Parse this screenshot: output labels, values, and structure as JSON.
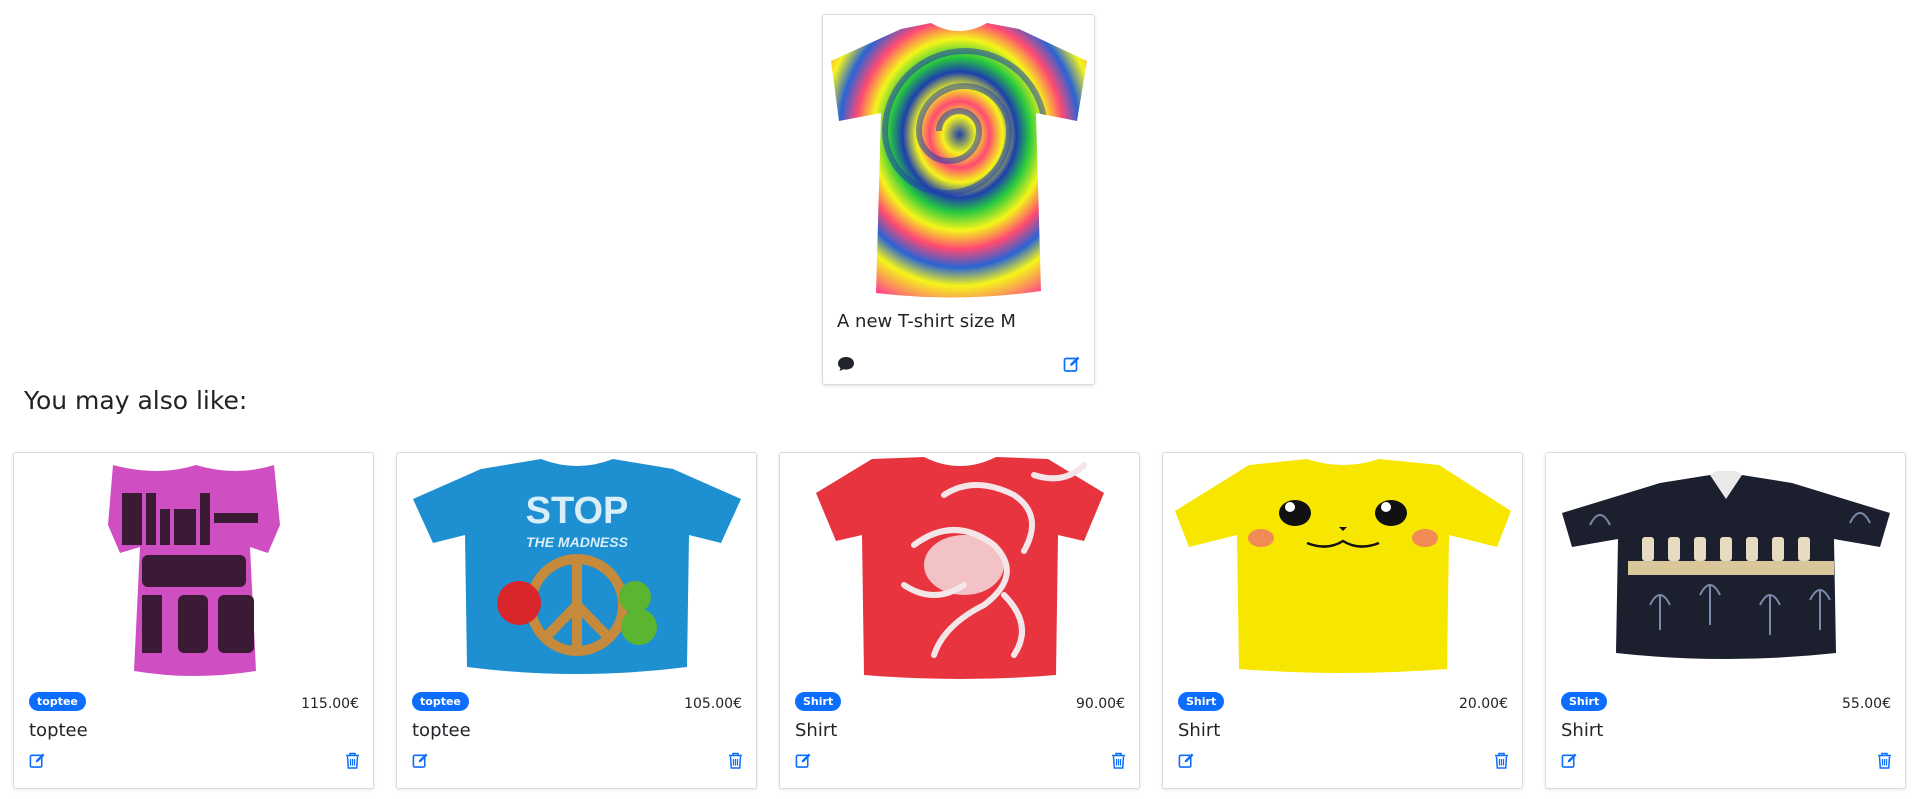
{
  "featured": {
    "title": "A new T-shirt size M",
    "image_icon": "tie-dye-tshirt-image",
    "comment_icon": "comment-icon",
    "edit_icon": "edit-icon"
  },
  "section_heading": "You may also like:",
  "colors": {
    "accent": "#0d6efd",
    "text": "#212529",
    "border": "#dcdcdc"
  },
  "products": [
    {
      "badge": "toptee",
      "price": "115.00€",
      "name": "toptee",
      "image": "pink-blink-182-tshirt-image",
      "shirt_color": "#cf4fc3"
    },
    {
      "badge": "toptee",
      "price": "105.00€",
      "name": "toptee",
      "image": "blue-stop-the-madness-tshirt-image",
      "shirt_color": "#1e8fd0"
    },
    {
      "badge": "Shirt",
      "price": "90.00€",
      "name": "Shirt",
      "image": "red-graphic-tshirt-image",
      "shirt_color": "#e8343f"
    },
    {
      "badge": "Shirt",
      "price": "20.00€",
      "name": "Shirt",
      "image": "yellow-pikachu-face-tshirt-image",
      "shirt_color": "#f7e600"
    },
    {
      "badge": "Shirt",
      "price": "55.00€",
      "name": "Shirt",
      "image": "black-hawaiian-shirt-image",
      "shirt_color": "#1b1f2e"
    }
  ]
}
